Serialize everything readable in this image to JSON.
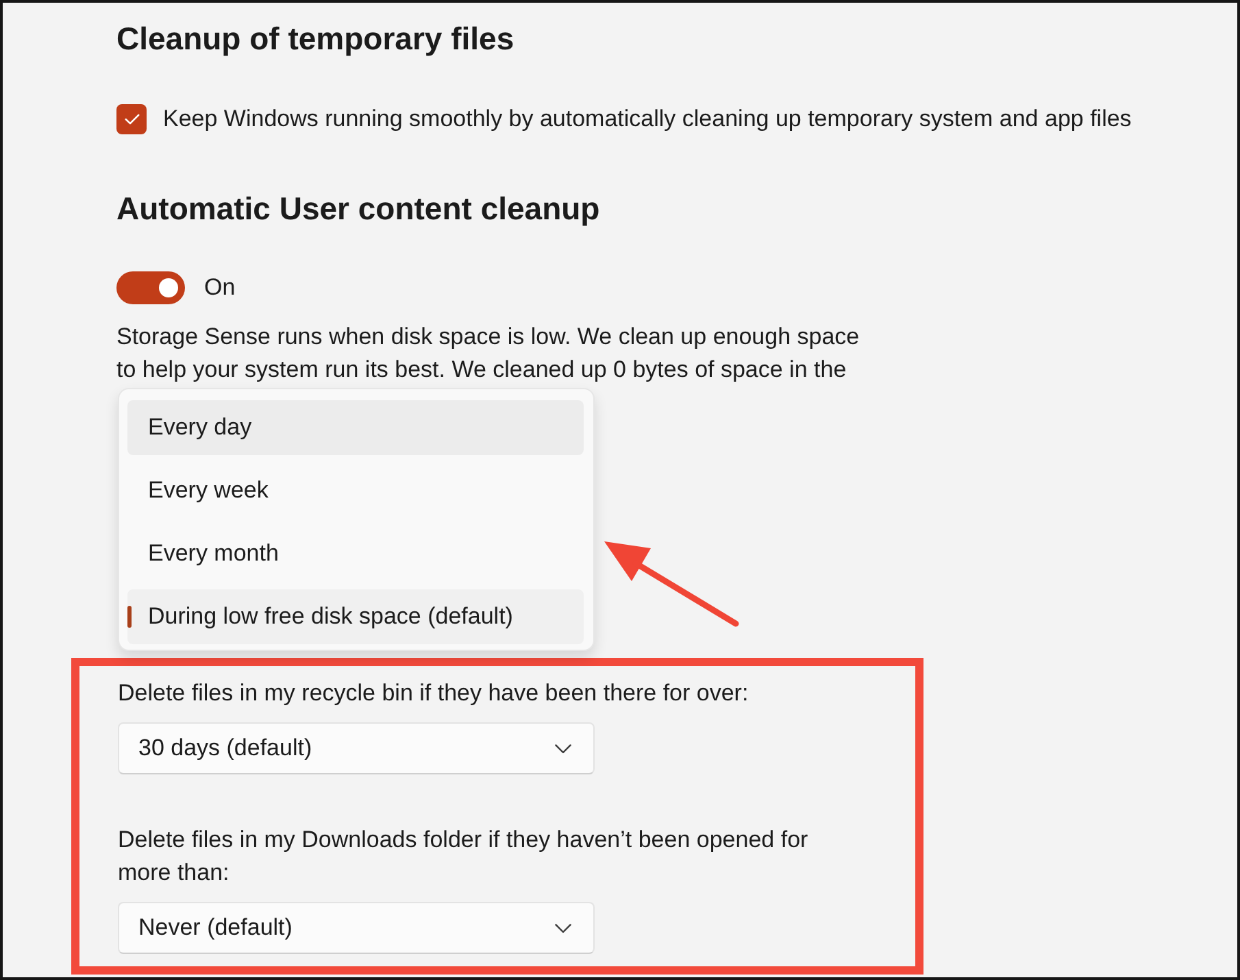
{
  "temporary_files": {
    "heading": "Cleanup of temporary files",
    "checkbox": {
      "label": "Keep Windows running smoothly by automatically cleaning up temporary system and app files",
      "checked": true
    }
  },
  "user_content_cleanup": {
    "heading": "Automatic User content cleanup",
    "toggle": {
      "label": "On",
      "on": true
    },
    "description": "Storage Sense runs when disk space is low. We clean up enough space to help your system run its best. We cleaned up 0 bytes of space in the"
  },
  "frequency_menu": {
    "items": [
      {
        "label": "Every day",
        "selected": false,
        "hovered": true
      },
      {
        "label": "Every week",
        "selected": false,
        "hovered": false
      },
      {
        "label": "Every month",
        "selected": false,
        "hovered": false
      },
      {
        "label": "During low free disk space (default)",
        "selected": true,
        "hovered": false
      }
    ]
  },
  "recycle_bin": {
    "label": "Delete files in my recycle bin if they have been there for over:",
    "dropdown": {
      "value": "30 days (default)"
    }
  },
  "downloads": {
    "label": "Delete files in my Downloads folder if they haven’t been opened for more than:",
    "dropdown": {
      "value": "Never (default)"
    }
  },
  "annotations": {
    "frame_around_settings": true,
    "arrow_to_menu": true
  }
}
